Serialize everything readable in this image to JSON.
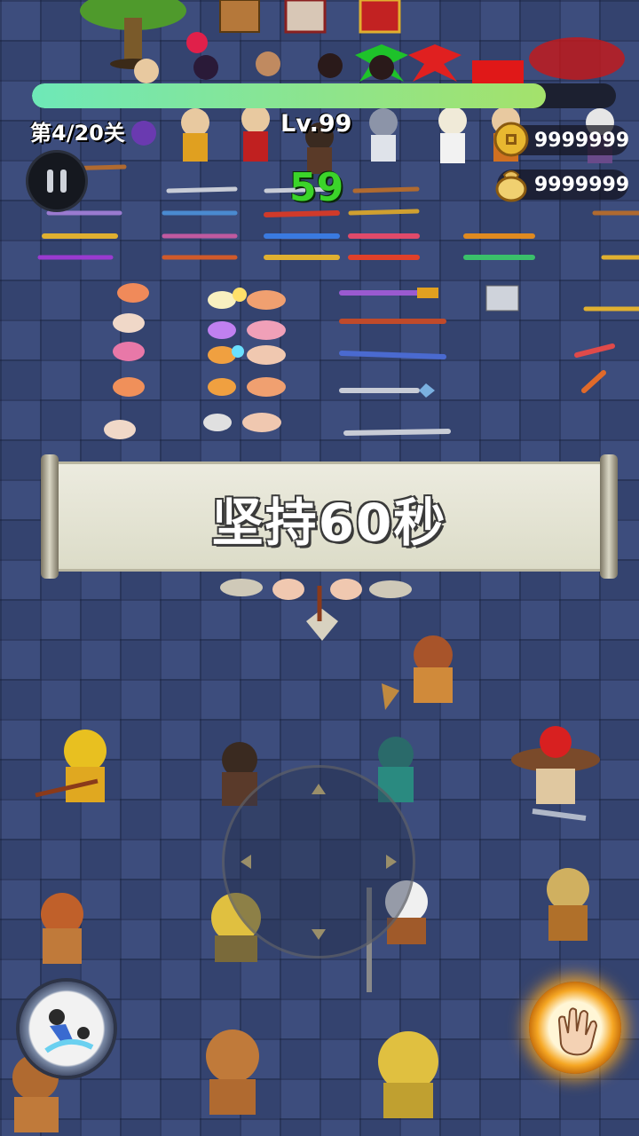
{
  "hud": {
    "stage_label": "第4/20关",
    "level_label": "Lv.99",
    "timer": "59",
    "hp_fraction": 0.88,
    "coins": "9999999",
    "ingots": "9999999"
  },
  "banner": {
    "text": "坚持60秒"
  },
  "icons": {
    "pause": "pause-icon",
    "coin": "coin-icon",
    "money_bag": "money-bag-icon",
    "skill_dash": "dash-skill-icon",
    "skill_palm": "palm-strike-icon",
    "joystick": "joystick-icon"
  },
  "colors": {
    "hp_bar": "#8fe48a",
    "timer": "#3bd42a",
    "floor": "#3d4d7d"
  }
}
